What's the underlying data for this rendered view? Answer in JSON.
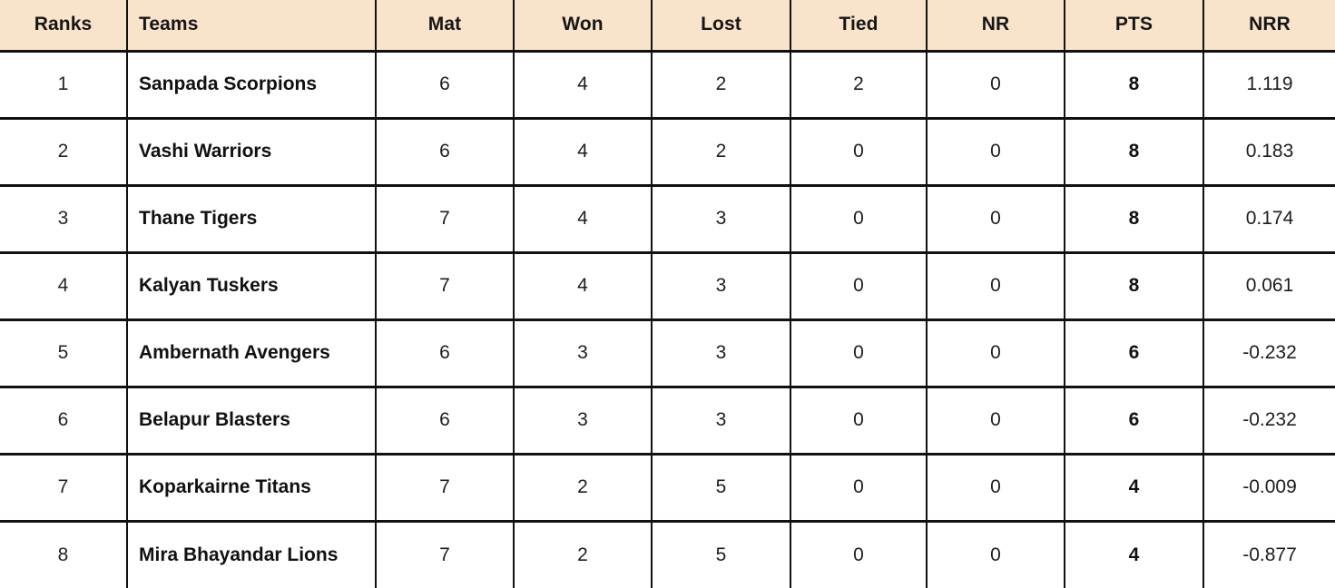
{
  "table": {
    "columns": [
      {
        "key": "rank",
        "label": "Ranks"
      },
      {
        "key": "team",
        "label": "Teams"
      },
      {
        "key": "mat",
        "label": "Mat"
      },
      {
        "key": "won",
        "label": "Won"
      },
      {
        "key": "lost",
        "label": "Lost"
      },
      {
        "key": "tied",
        "label": "Tied"
      },
      {
        "key": "nr",
        "label": "NR"
      },
      {
        "key": "pts",
        "label": "PTS"
      },
      {
        "key": "nrr",
        "label": "NRR"
      }
    ],
    "header_background": "#fae3cb",
    "border_color": "#111111",
    "rows": [
      {
        "rank": "1",
        "team": "Sanpada Scorpions",
        "mat": "6",
        "won": "4",
        "lost": "2",
        "tied": "2",
        "nr": "0",
        "pts": "8",
        "nrr": "1.119"
      },
      {
        "rank": "2",
        "team": "Vashi Warriors",
        "mat": "6",
        "won": "4",
        "lost": "2",
        "tied": "0",
        "nr": "0",
        "pts": "8",
        "nrr": "0.183"
      },
      {
        "rank": "3",
        "team": "Thane Tigers",
        "mat": "7",
        "won": "4",
        "lost": "3",
        "tied": "0",
        "nr": "0",
        "pts": "8",
        "nrr": "0.174"
      },
      {
        "rank": "4",
        "team": "Kalyan Tuskers",
        "mat": "7",
        "won": "4",
        "lost": "3",
        "tied": "0",
        "nr": "0",
        "pts": "8",
        "nrr": "0.061"
      },
      {
        "rank": "5",
        "team": "Ambernath Avengers",
        "mat": "6",
        "won": "3",
        "lost": "3",
        "tied": "0",
        "nr": "0",
        "pts": "6",
        "nrr": "-0.232"
      },
      {
        "rank": "6",
        "team": "Belapur Blasters",
        "mat": "6",
        "won": "3",
        "lost": "3",
        "tied": "0",
        "nr": "0",
        "pts": "6",
        "nrr": "-0.232"
      },
      {
        "rank": "7",
        "team": "Koparkairne Titans",
        "mat": "7",
        "won": "2",
        "lost": "5",
        "tied": "0",
        "nr": "0",
        "pts": "4",
        "nrr": "-0.009"
      },
      {
        "rank": "8",
        "team": "Mira Bhayandar Lions",
        "mat": "7",
        "won": "2",
        "lost": "5",
        "tied": "0",
        "nr": "0",
        "pts": "4",
        "nrr": "-0.877"
      }
    ]
  }
}
